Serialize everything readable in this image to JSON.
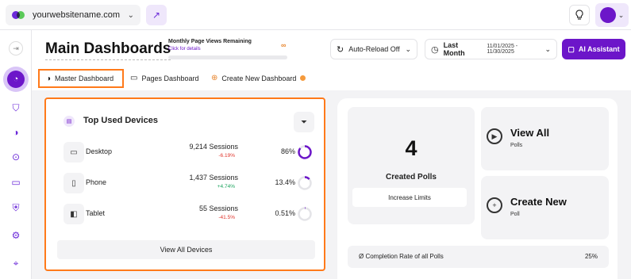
{
  "topbar": {
    "site_name": "yourwebsitename.com"
  },
  "header": {
    "title": "Main Dashboards",
    "quota_label": "Monthly Page Views Remaining",
    "quota_link": "Click for details",
    "quota_value": "∞",
    "reload_label": "Auto-Reload Off",
    "period_label": "Last Month",
    "date_range": "11/01/2025 - 11/30/2025",
    "ai_label": "AI Assistant"
  },
  "tabs": [
    {
      "label": "Master Dashboard"
    },
    {
      "label": "Pages Dashboard"
    },
    {
      "label": "Create New Dashboard"
    }
  ],
  "devices": {
    "title": "Top Used Devices",
    "rows": [
      {
        "name": "Desktop",
        "sessions": "9,214 Sessions",
        "change": "-6.19%",
        "percent": "86%",
        "fraction": 0.86
      },
      {
        "name": "Phone",
        "sessions": "1,437 Sessions",
        "change": "+4.74%",
        "percent": "13.4%",
        "fraction": 0.134
      },
      {
        "name": "Tablet",
        "sessions": "55 Sessions",
        "change": "-41.5%",
        "percent": "0.51%",
        "fraction": 0.0051
      }
    ],
    "view_all": "View All Devices"
  },
  "polls": {
    "count": "4",
    "count_label": "Created Polls",
    "increase_label": "Increase Limits",
    "view_all_title": "View All",
    "view_all_sub": "Polls",
    "create_title": "Create New",
    "create_sub": "Poll",
    "completion_label": "Ø Completion Rate of all Polls",
    "completion_value": "25%"
  },
  "colors": {
    "accent": "#6c16c9",
    "highlight": "#ff7a1a",
    "negative": "#e0342b",
    "positive": "#1aa35c"
  }
}
